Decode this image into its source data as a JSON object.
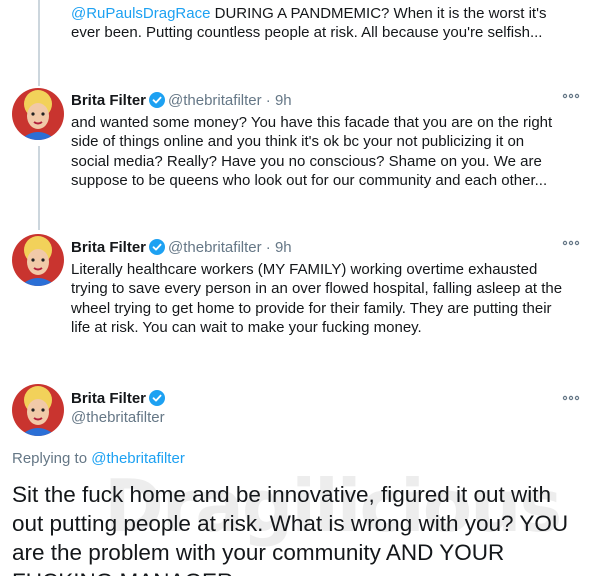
{
  "colors": {
    "accent": "#1da1f2",
    "text": "#14171a",
    "muted": "#657786",
    "thread_line": "#ccd6dd"
  },
  "top_fragment": {
    "mention": "@RuPaulsDragRace",
    "line1_rest": " DURING A PANDMEMIC? When it is the worst it's",
    "line2": "ever been. Putting countless people at risk. All because you're selfish..."
  },
  "tweets": [
    {
      "name": "Brita Filter",
      "handle": "@thebritafilter",
      "dot": "·",
      "time": "9h",
      "more_icon": "more-dots-icon",
      "lines": [
        "and wanted some money? You have this facade that you are on the right",
        "side of things online and you think it's ok bc your not publicizing it on",
        "social media? Really? Have you no conscious? Shame on you. We are",
        "suppose to be queens who look out for our community and each other..."
      ]
    },
    {
      "name": "Brita Filter",
      "handle": "@thebritafilter",
      "dot": "·",
      "time": "9h",
      "more_icon": "more-dots-icon",
      "lines": [
        "Literally healthcare workers (MY FAMILY) working overtime exhausted",
        "trying to save every person in an over flowed hospital, falling asleep at the",
        "wheel trying to get home to provide for their family. They are putting their",
        "life at risk. You can wait to make your fucking money."
      ]
    }
  ],
  "main_tweet": {
    "name": "Brita Filter",
    "handle": "@thebritafilter",
    "replying_prefix": "Replying to ",
    "replying_mention": "@thebritafilter",
    "lines": [
      "Sit the fuck home and be innovative, figured it out with",
      "out putting people at risk. What is wrong with you? YOU",
      "are the problem with your community AND YOUR",
      "FUCKING MANAGER"
    ]
  },
  "watermark": "Dragilicious"
}
